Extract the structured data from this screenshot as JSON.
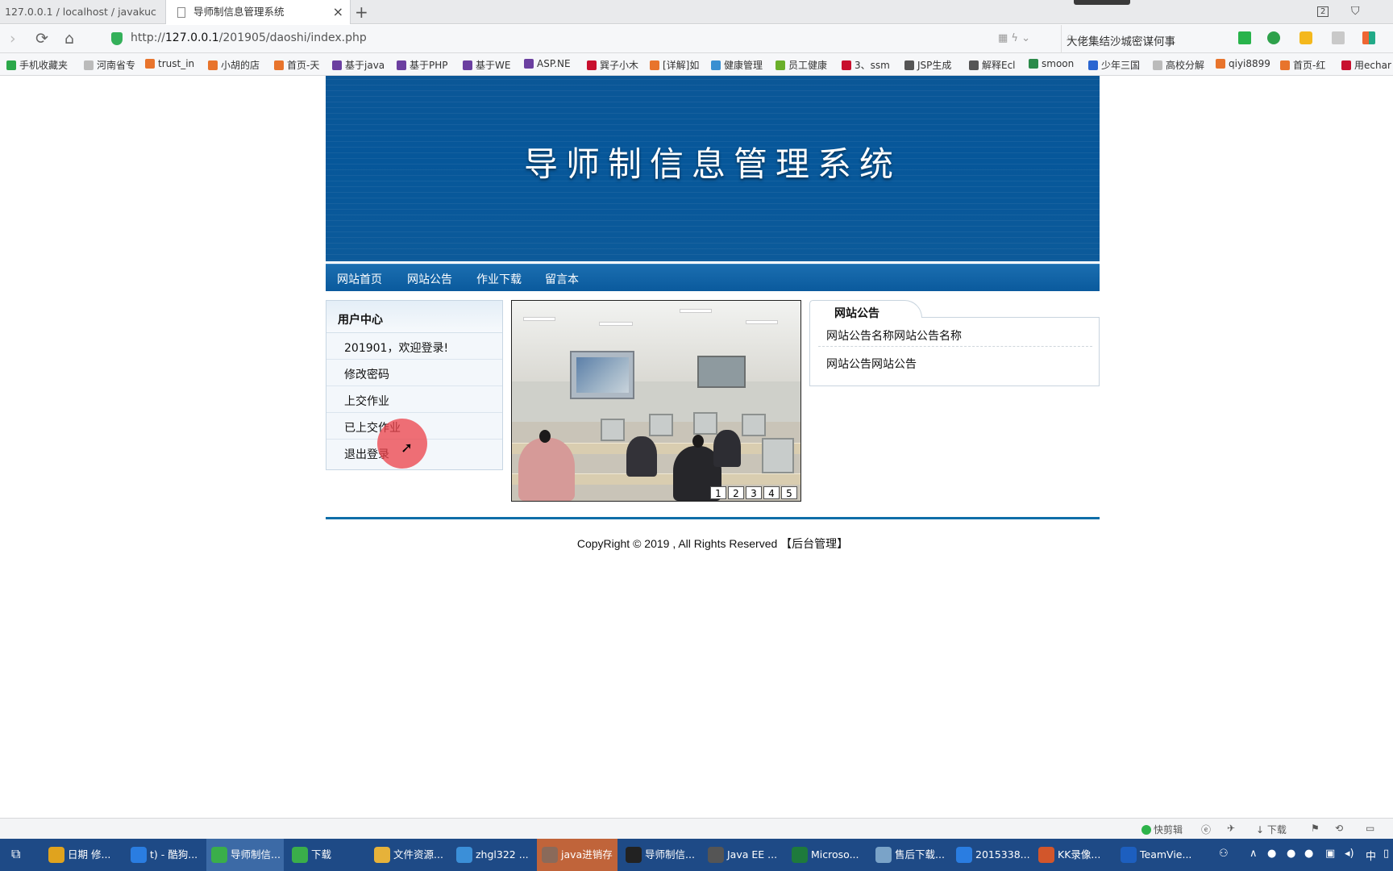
{
  "browser": {
    "tabs": [
      {
        "label": "127.0.0.1 / localhost / javakuc"
      },
      {
        "label": "导师制信息管理系统"
      }
    ],
    "new_tab": "+",
    "window_badge": "2",
    "url_prefix": "http://",
    "url_host": "127.0.0.1",
    "url_path": "/201905/daoshi/index.php",
    "search_text": "大佬集结沙城密谋何事",
    "bookmarks": [
      "手机收藏夹",
      "河南省专",
      "trust_in",
      "小胡的店",
      "首页-天",
      "基于java",
      "基于PHP",
      "基于WE",
      "ASP.NE",
      "巽子小木",
      "[详解]如",
      "健康管理",
      "员工健康",
      "3、ssm",
      "JSP生成",
      "解释Ecl",
      "smoon",
      "少年三国",
      "高校分解",
      "qiyi8899",
      "首页-红",
      "用echar"
    ]
  },
  "site": {
    "banner_title": "导师制信息管理系统",
    "nav": [
      "网站首页",
      "网站公告",
      "作业下载",
      "留言本"
    ],
    "user_center": {
      "title": "用户中心",
      "items": [
        "201901，欢迎登录!",
        "修改密码",
        "上交作业",
        "已上交作业",
        "退出登录"
      ]
    },
    "slider_pages": [
      "1",
      "2",
      "3",
      "4",
      "5"
    ],
    "notice": {
      "title": "网站公告",
      "items": [
        "网站公告名称网站公告名称",
        "网站公告网站公告"
      ]
    },
    "footer": {
      "copyright": "CopyRight © 2019 , All Rights Reserved ",
      "admin_link": "【后台管理】"
    }
  },
  "statusbar": {
    "items": [
      "快剪辑",
      "下载"
    ]
  },
  "taskbar": {
    "items": [
      "日期 修...",
      "t) - 酷狗...",
      "导师制信...",
      "下载",
      "文件资源...",
      "zhgl322 ...",
      "java进销存",
      "导师制信...",
      "Java EE ...",
      "Microso...",
      "售后下载...",
      "2015338...",
      "KK录像...",
      "TeamVie..."
    ],
    "tray_lang": "中"
  },
  "colors": {
    "banner": "#06579a",
    "nav": "#0a5a9d",
    "accent_line": "#0e6ea8",
    "taskbar": "#1e4a86"
  }
}
